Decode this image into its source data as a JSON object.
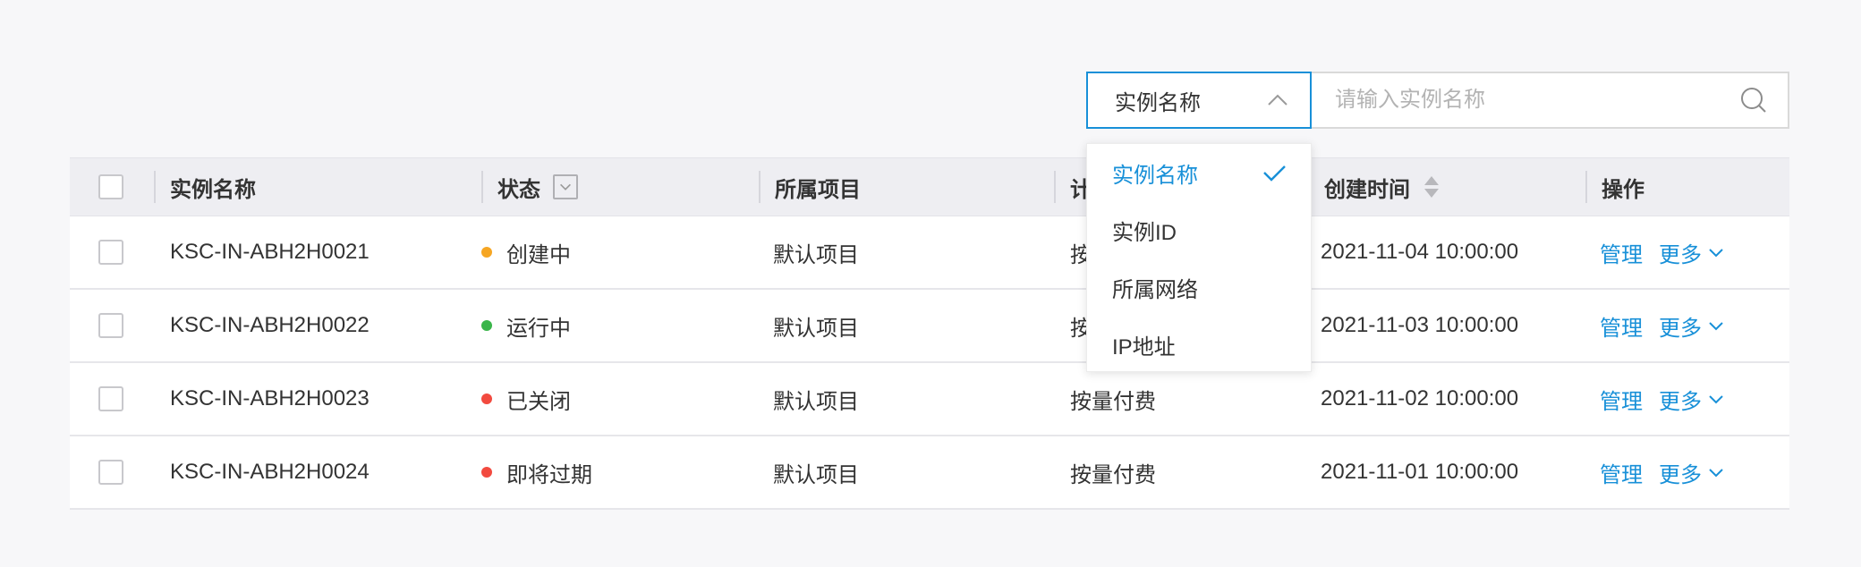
{
  "colors": {
    "accent": "#1890d8",
    "status_creating": "#f6a623",
    "status_running": "#3ab54a",
    "status_closed": "#f24a3f",
    "status_expiring": "#f24a3f"
  },
  "search": {
    "type_label": "实例名称",
    "placeholder": "请输入实例名称",
    "dropdown_icon": "chevron-up-icon",
    "search_icon": "search-icon"
  },
  "dropdown": {
    "options": [
      "实例名称",
      "实例ID",
      "所属网络",
      "IP地址"
    ],
    "selected": "实例名称"
  },
  "table": {
    "headers": {
      "name": "实例名称",
      "status": "状态",
      "project": "所属项目",
      "billing": "计",
      "created": "创建时间",
      "actions": "操作"
    },
    "rows": [
      {
        "name": "KSC-IN-ABH2H0021",
        "status": "创建中",
        "status_color": "#f6a623",
        "project": "默认项目",
        "billing": "按",
        "created": "2021-11-04 10:00:00",
        "manage": "管理",
        "more": "更多"
      },
      {
        "name": "KSC-IN-ABH2H0022",
        "status": "运行中",
        "status_color": "#3ab54a",
        "project": "默认项目",
        "billing": "按",
        "created": "2021-11-03 10:00:00",
        "manage": "管理",
        "more": "更多"
      },
      {
        "name": "KSC-IN-ABH2H0023",
        "status": "已关闭",
        "status_color": "#f24a3f",
        "project": "默认项目",
        "billing": "按量付费",
        "created": "2021-11-02 10:00:00",
        "manage": "管理",
        "more": "更多"
      },
      {
        "name": "KSC-IN-ABH2H0024",
        "status": "即将过期",
        "status_color": "#f24a3f",
        "project": "默认项目",
        "billing": "按量付费",
        "created": "2021-11-01 10:00:00",
        "manage": "管理",
        "more": "更多"
      }
    ]
  }
}
